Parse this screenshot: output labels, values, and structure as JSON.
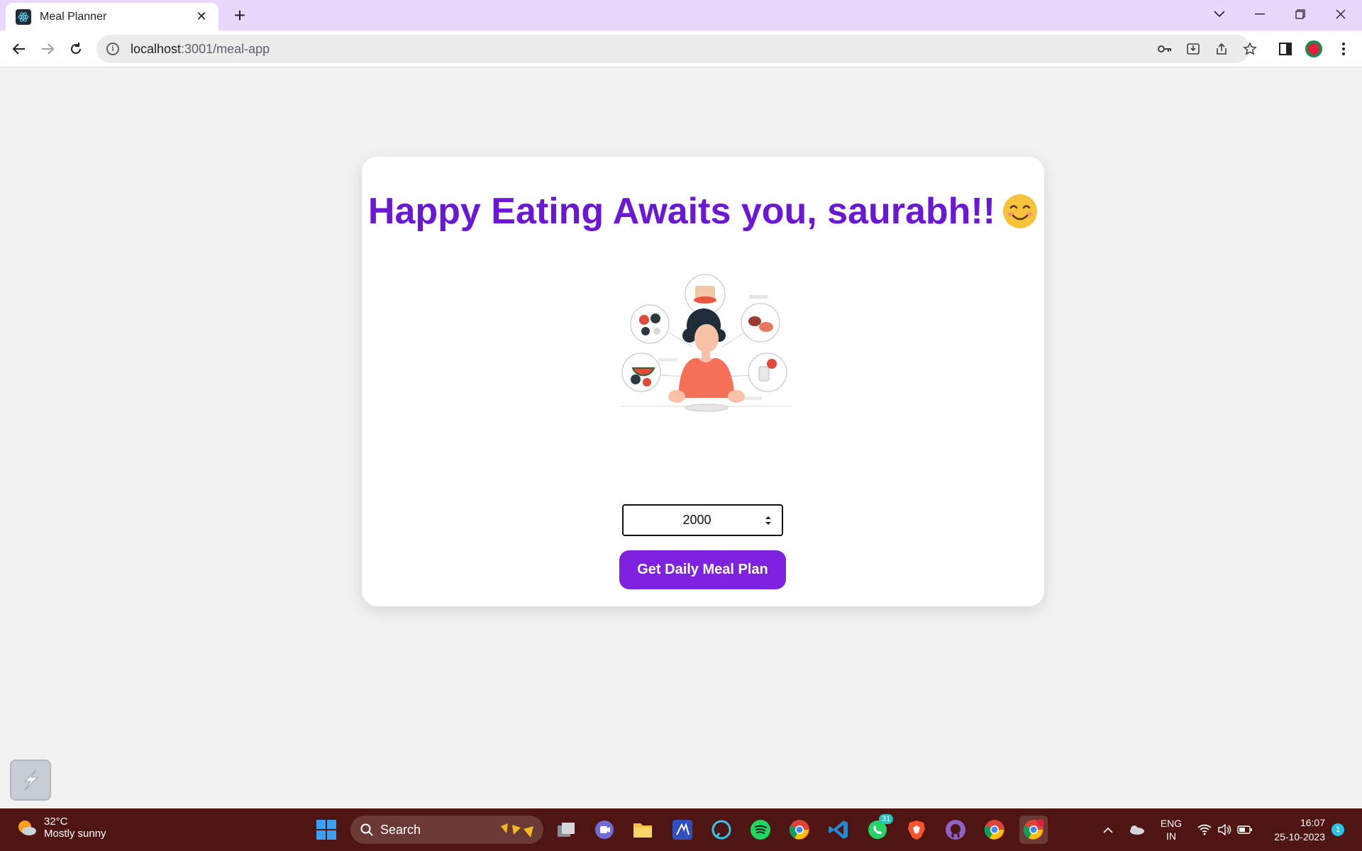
{
  "browser": {
    "tab_title": "Meal Planner",
    "url_host": "localhost",
    "url_path": ":3001/meal-app"
  },
  "page": {
    "heading": "Happy Eating Awaits you, saurabh!!",
    "calories_value": "2000",
    "button_label": "Get Daily Meal Plan"
  },
  "taskbar": {
    "weather_temp": "32°C",
    "weather_desc": "Mostly sunny",
    "search_label": "Search",
    "whatsapp_badge": "31",
    "lang_line1": "ENG",
    "lang_line2": "IN",
    "time": "16:07",
    "date": "25-10-2023",
    "notification_count": "1"
  },
  "colors": {
    "accent": "#7e22e0",
    "heading": "#6a17d6",
    "tabbar": "#e9d8fb",
    "taskbar": "#4e1513"
  }
}
